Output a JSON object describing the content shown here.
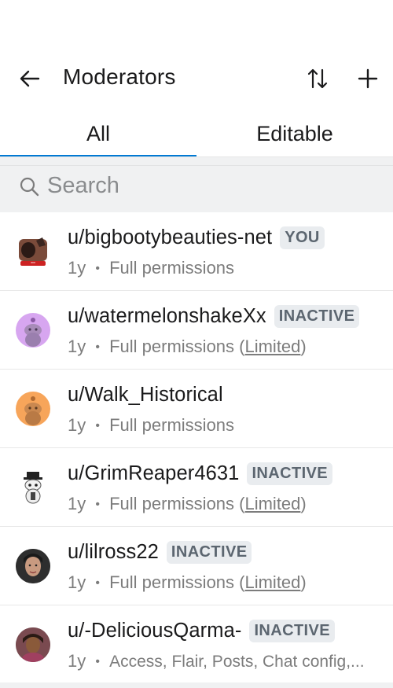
{
  "header": {
    "title": "Moderators",
    "back_icon": "arrow-left-icon",
    "sort_icon": "sort-icon",
    "add_icon": "plus-icon"
  },
  "tabs": [
    {
      "label": "All",
      "active": true
    },
    {
      "label": "Editable",
      "active": false
    }
  ],
  "search": {
    "placeholder": "Search"
  },
  "moderators": [
    {
      "username": "u/bigbootybeauties-net",
      "badge": "YOU",
      "age": "1y",
      "sep": "•",
      "perms": "Full permissions",
      "limited": "",
      "avatar": "custom-avatar-1"
    },
    {
      "username": "u/watermelonshakeXx",
      "badge": "INACTIVE",
      "age": "1y",
      "sep": "•",
      "perms": "Full permissions (",
      "limited": "Limited",
      "avatar": "snoo-purple"
    },
    {
      "username": "u/Walk_Historical",
      "badge": "",
      "age": "1y",
      "sep": "•",
      "perms": "Full permissions",
      "limited": "",
      "avatar": "snoo-orange"
    },
    {
      "username": "u/GrimReaper4631",
      "badge": "INACTIVE",
      "age": "1y",
      "sep": "•",
      "perms": "Full permissions (",
      "limited": "Limited",
      "avatar": "snoo-hat"
    },
    {
      "username": "u/lilross22",
      "badge": "INACTIVE",
      "age": "1y",
      "sep": "•",
      "perms": "Full permissions (",
      "limited": "Limited",
      "avatar": "photo-avatar-1"
    },
    {
      "username": "u/-DeliciousQarma-",
      "badge": "INACTIVE",
      "age": "1y",
      "sep": "•",
      "perms": "Access, Flair, Posts, Chat config,...",
      "limited": "",
      "avatar": "photo-avatar-2"
    }
  ],
  "colors": {
    "accent": "#0079d3",
    "badge_bg": "#e9ecef",
    "badge_text": "#5c6670"
  }
}
